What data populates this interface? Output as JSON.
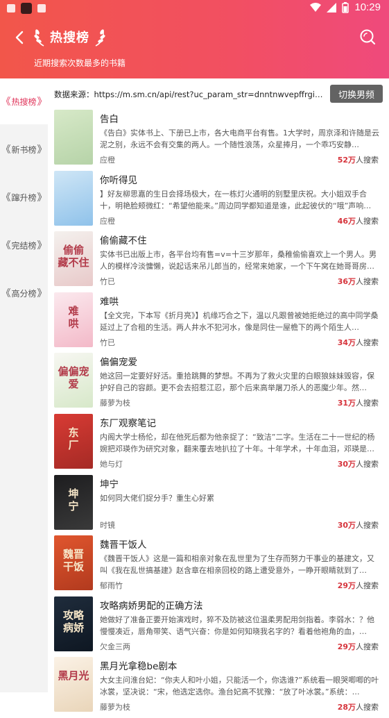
{
  "status_bar": {
    "time": "10:29"
  },
  "header": {
    "title": "热搜榜",
    "subtitle": "近期搜索次数最多的书籍"
  },
  "sidebar": {
    "items": [
      {
        "label": "热搜榜",
        "active": true
      },
      {
        "label": "新书榜",
        "active": false
      },
      {
        "label": "蹿升榜",
        "active": false
      },
      {
        "label": "完结榜",
        "active": false
      },
      {
        "label": "高分榜",
        "active": false
      }
    ]
  },
  "source": {
    "label": "数据来源：https://m.sm.cn/api/rest?uc_param_str=dnntnwvepffrgibijbprsvd...",
    "switch_label": "切换男频"
  },
  "search_suffix": "人搜索",
  "books": [
    {
      "title": "告白",
      "desc": "《告白》实体书上、下册已上市，各大电商平台有售。1大学时，周京泽和许随是云泥之别，永远不会有交集的两人。一个随性浪荡，众星捧月，一个乖巧安静…",
      "author": "应橙",
      "count": "52万",
      "cover_text": "",
      "cover_colors": [
        "#d7e9c8",
        "#b6d3a8"
      ]
    },
    {
      "title": "你听得见",
      "desc": "】好友柳思嘉的生日会择场极大，在一栋灯火通明的别墅里庆祝。大小姐双手合十，明艳脸颊微红：“希望他能来。”周边同学都知道是谁，此起彼伏的“哦”声响…",
      "author": "应橙",
      "count": "46万",
      "cover_text": "",
      "cover_colors": [
        "#cfe6f6",
        "#8fc2ea"
      ]
    },
    {
      "title": "偷偷藏不住",
      "desc": "实体书已出版上市，各平台均有售=v=十三岁那年，桑稚偷偷喜欢上一个男人。男人的模样冷淡慵懒，说起话来吊儿郎当的，经常来她家，一个下午窝在她哥哥房…",
      "author": "竹已",
      "count": "36万",
      "cover_text": "偷偷\n藏不住",
      "cover_colors": [
        "#f4f1ee",
        "#e8c9c9"
      ]
    },
    {
      "title": "难哄",
      "desc": "【全文完，下本写《折月亮》】机缘巧合之下，温以凡跟曾被她拒绝过的高中同学桑延过上了合租的生活。两人井水不犯河水，像是同住一屋檐下的两个陌生人…",
      "author": "竹已",
      "count": "34万",
      "cover_text": "难\n哄",
      "cover_colors": [
        "#fbe9ee",
        "#f3b9c8"
      ]
    },
    {
      "title": "偏偏宠爱",
      "desc": "她这回一定要好好活。重拾跳舞的梦想。不再为了救火灾里的白眼狼妹妹毁容，保护好自己的容颜。更不会去招惹江忍，那个后来高举屠刀杀人的恶魔少年。然…",
      "author": "藤萝为枝",
      "count": "31万",
      "cover_text": "偏偏宠爱",
      "cover_colors": [
        "#f7f7f2",
        "#d7e8c9"
      ]
    },
    {
      "title": "东厂观察笔记",
      "desc": "内阁大学士杨伦，却在他死后都为他亲捉了：“致洁”二字。生活在二十一世纪的杨婉把邓瑛作为研究对象，翻来覆去地扒拉了十年。十年学术，十年血泪，邓瑛是…",
      "author": "她与灯",
      "count": "30万",
      "cover_text": "东\n厂",
      "cover_colors": [
        "#d83b34",
        "#a52a25"
      ]
    },
    {
      "title": "坤宁",
      "desc": "如何同大佬们捉分手？重生心好累",
      "author": "时镜",
      "count": "30万",
      "cover_text": "坤\n宁",
      "cover_colors": [
        "#1d1d1f",
        "#3a3a3a"
      ]
    },
    {
      "title": "魏晋干饭人",
      "desc": "《魏晋干饭人》这是一篇和相亲对象在乱世里为了生存而努力干事业的基建文，又叫《我在乱世搞基建》赵含章在相亲回校的路上遭受意外，一睁开眼睛就到了…",
      "author": "郁雨竹",
      "count": "29万",
      "cover_text": "魏晋\n干饭",
      "cover_colors": [
        "#e0562e",
        "#b23a1e"
      ]
    },
    {
      "title": "攻略病娇男配的正确方法",
      "desc": "她做好了准备正要开始演戏时，猝不及防被这位温柔男配用剑指着。李弱水：？他慢慢凑近，唇角带笑、语气兴奋：你是如何知晓我名字的？看着他袍角的血，…",
      "author": "欠金三两",
      "count": "29万",
      "cover_text": "攻略\n病娇",
      "cover_colors": [
        "#1f2c3c",
        "#0e1722"
      ]
    },
    {
      "title": "黑月光拿稳be剧本",
      "desc": "大女主问淮台妃：“你夫人和叶小姐，只能活一个，你选谁?”系统看一眼哭唧唧的叶冰裳，坚决说：“宋，他选定选你。渔台妃高不犹豫：“放了叶冰裳。”系统：…",
      "author": "藤萝为枝",
      "count": "28万",
      "cover_text": "黑月光",
      "cover_colors": [
        "#fbf2e6",
        "#e9d5b9"
      ]
    }
  ]
}
